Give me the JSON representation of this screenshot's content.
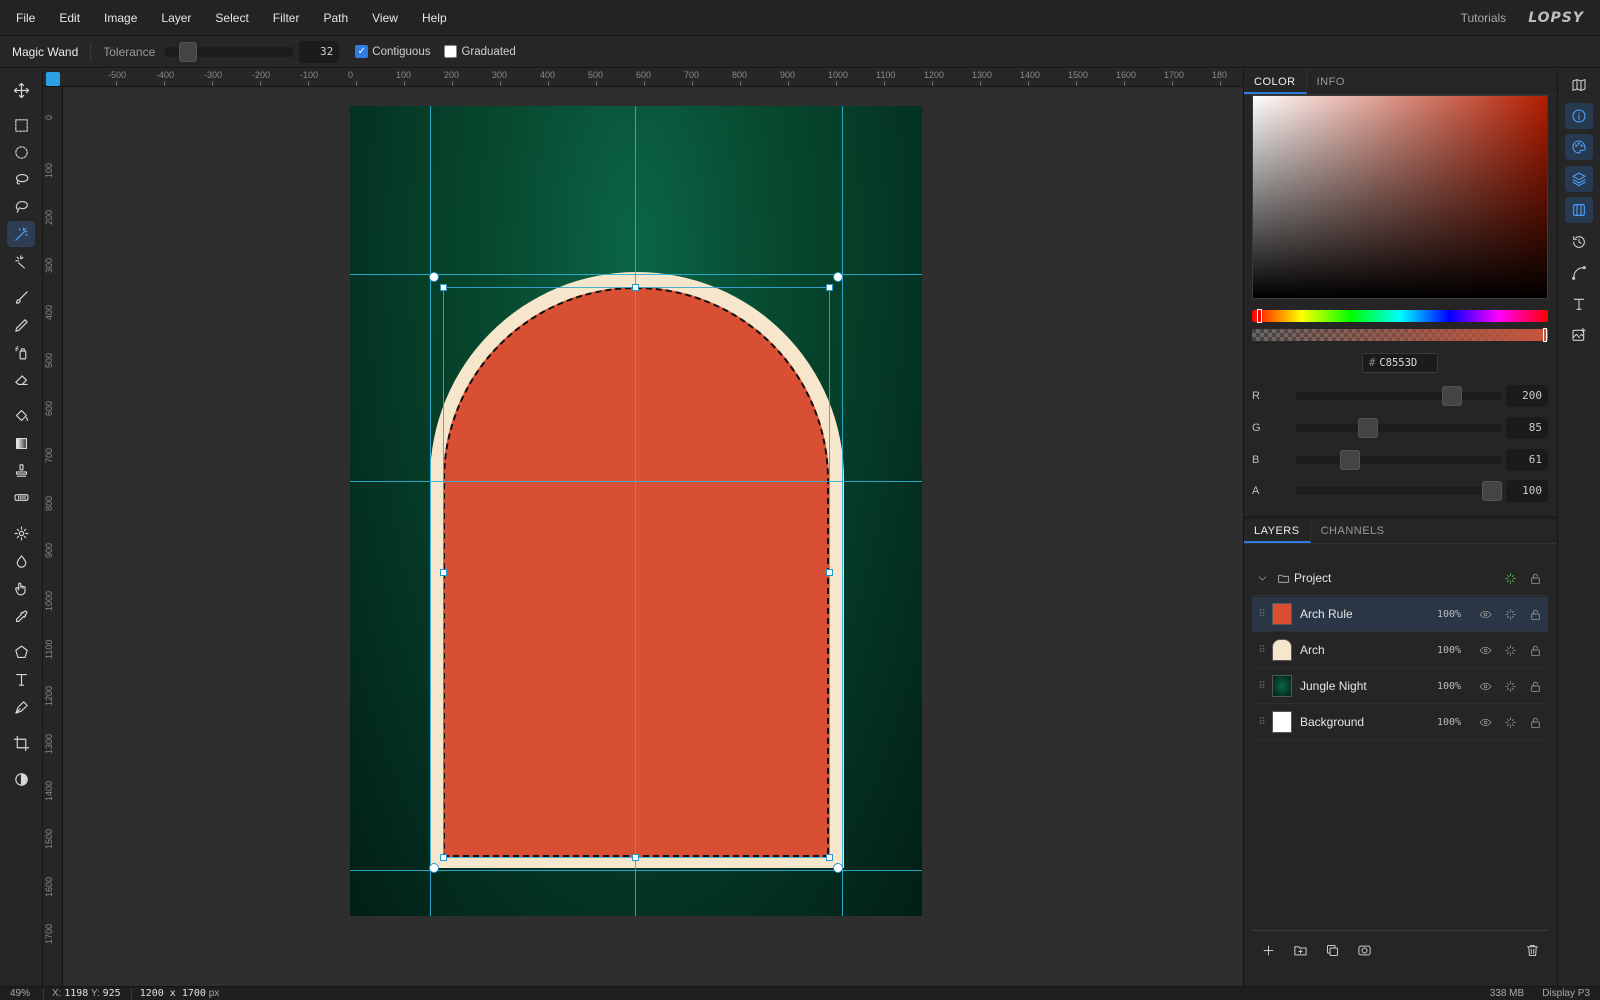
{
  "menu": {
    "items": [
      "File",
      "Edit",
      "Image",
      "Layer",
      "Select",
      "Filter",
      "Path",
      "View",
      "Help"
    ],
    "tutorials": "Tutorials",
    "logo": "LOPSY"
  },
  "options": {
    "tool_name": "Magic Wand",
    "tolerance_label": "Tolerance",
    "tolerance_value": "32",
    "contiguous_label": "Contiguous",
    "contiguous_checked": true,
    "graduated_label": "Graduated",
    "graduated_checked": false
  },
  "tools": [
    "move-icon",
    "rect-select-icon",
    "ellipse-select-icon",
    "lasso-icon",
    "magnetic-lasso-icon",
    "magic-wand-icon",
    "quick-select-icon",
    "brush-icon",
    "pencil-icon",
    "spray-icon",
    "eraser-icon",
    "fill-icon",
    "gradient-icon",
    "stamp-icon",
    "heal-icon",
    "dodge-icon",
    "blur-icon",
    "smudge-icon",
    "eyedropper-icon",
    "shape-icon",
    "text-icon",
    "pen-icon",
    "crop-icon",
    "contrast-icon"
  ],
  "active_tool": "magic-wand-icon",
  "ruler": {
    "top_labels": [
      "-500",
      "-400",
      "-300",
      "-200",
      "-100",
      "0",
      "100",
      "200",
      "300",
      "400",
      "500",
      "600",
      "700",
      "800",
      "900",
      "1000",
      "1100",
      "1200",
      "1300",
      "1400",
      "1500",
      "1600",
      "1700",
      "180"
    ],
    "left_labels": [
      "0",
      "100",
      "200",
      "300",
      "400",
      "500",
      "600",
      "700",
      "800",
      "900",
      "1000",
      "1100",
      "1200",
      "1300",
      "1400",
      "1500",
      "1600",
      "1700"
    ]
  },
  "document": {
    "background_colors": [
      "#0b6548",
      "#021f15"
    ],
    "arch_frame_color": "#f5e6cc",
    "arch_fill_color": "#d84f34",
    "guide_color": "#2bb0d8"
  },
  "status": {
    "zoom": "49%",
    "x_label": "X:",
    "x": "1198",
    "y_label": "Y:",
    "y": "925",
    "size": "1200 x 1700",
    "size_unit": "px",
    "memory": "338 MB",
    "color_profile": "Display P3"
  },
  "color_panel": {
    "tab_color": "COLOR",
    "tab_info": "INFO",
    "hex_prefix": "#",
    "hex": "C8553D",
    "channels": [
      {
        "label": "R",
        "value": "200",
        "fraction": 0.784
      },
      {
        "label": "G",
        "value": "85",
        "fraction": 0.333
      },
      {
        "label": "B",
        "value": "61",
        "fraction": 0.239
      },
      {
        "label": "A",
        "value": "100",
        "fraction": 1.0
      }
    ]
  },
  "layers_panel": {
    "tab_layers": "LAYERS",
    "tab_channels": "CHANNELS",
    "group": "Project",
    "layers": [
      {
        "name": "Arch Rule",
        "opacity": "100%",
        "thumb": "#d84f34"
      },
      {
        "name": "Arch",
        "opacity": "100%",
        "thumb": "#f5e6cc"
      },
      {
        "name": "Jungle Night",
        "opacity": "100%",
        "thumb": "#0a4a33"
      },
      {
        "name": "Background",
        "opacity": "100%",
        "thumb": "#ffffff"
      }
    ]
  },
  "right_strip": [
    "map-icon",
    "info-icon",
    "palette-icon",
    "layers-icon",
    "columns-icon",
    "history-icon",
    "path-icon",
    "text-icon",
    "image-adjust-icon"
  ]
}
